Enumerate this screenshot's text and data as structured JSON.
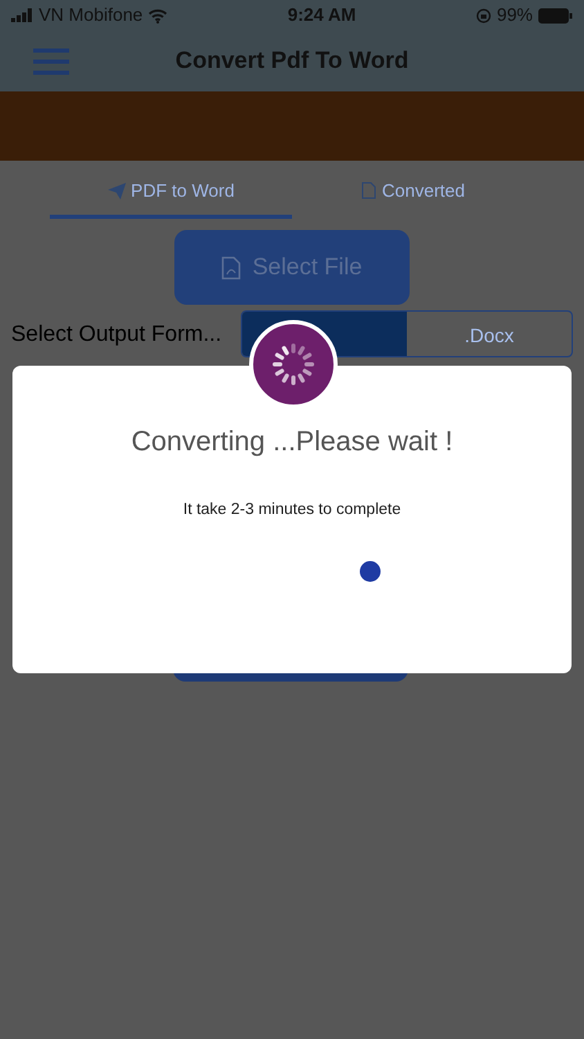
{
  "status_bar": {
    "carrier": "VN Mobifone",
    "time": "9:24 AM",
    "battery": "99%"
  },
  "header": {
    "title": "Convert Pdf To Word"
  },
  "tabs": [
    {
      "label": "PDF to Word",
      "selected": true
    },
    {
      "label": "Converted",
      "selected": false
    }
  ],
  "select_file_button": "Select File",
  "output_format": {
    "label": "Select Output Form...",
    "options": [
      {
        "selected": true
      },
      {
        "label": ".Docx",
        "selected": false
      }
    ]
  },
  "dialog": {
    "title": "Converting ...Please wait !",
    "message": "It take 2-3 minutes to complete"
  }
}
